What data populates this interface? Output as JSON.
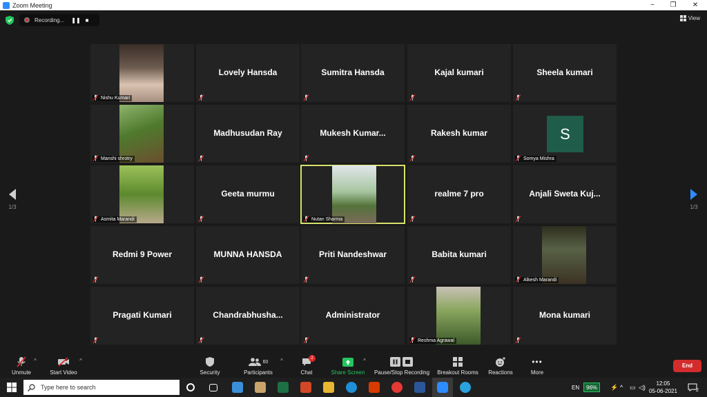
{
  "window": {
    "title": "Zoom Meeting",
    "minimize": "−",
    "maximize": "❐",
    "close": "✕"
  },
  "recording": {
    "status": "Recording...",
    "pause": "❚❚",
    "stop": "■"
  },
  "view": {
    "label": "View"
  },
  "pager": {
    "left": "1/3",
    "right": "1/3"
  },
  "participants": [
    {
      "name": "Nishu Kumari",
      "video": true
    },
    {
      "name": "Lovely Hansda",
      "video": false
    },
    {
      "name": "Sumitra Hansda",
      "video": false
    },
    {
      "name": "Kajal kumari",
      "video": false
    },
    {
      "name": "Sheela kumari",
      "video": false
    },
    {
      "name": "Manshi shrotry",
      "video": true
    },
    {
      "name": "Madhusudan Ray",
      "video": false
    },
    {
      "name": "Mukesh  Kumar...",
      "video": false
    },
    {
      "name": "Rakesh kumar",
      "video": false
    },
    {
      "name": "Somya Mishra",
      "video": false,
      "avatar": "S"
    },
    {
      "name": "Asmita Marandi",
      "video": true
    },
    {
      "name": "Geeta murmu",
      "video": false
    },
    {
      "name": "Nutan Sharma",
      "video": true,
      "active": true
    },
    {
      "name": "realme 7 pro",
      "video": false
    },
    {
      "name": "Anjali  Sweta  Kuj...",
      "video": false
    },
    {
      "name": "Redmi 9 Power",
      "video": false
    },
    {
      "name": "MUNNA HANSDA",
      "video": false
    },
    {
      "name": "Priti Nandeshwar",
      "video": false
    },
    {
      "name": "Babita kumari",
      "video": false
    },
    {
      "name": "Alkesh Marandi",
      "video": true
    },
    {
      "name": "Pragati Kumari",
      "video": false
    },
    {
      "name": "Chandrabhusha...",
      "video": false
    },
    {
      "name": "Administrator",
      "video": false
    },
    {
      "name": "Reshma Agrawal",
      "video": true
    },
    {
      "name": "Mona kumari",
      "video": false
    }
  ],
  "toolbar": {
    "unmute": "Unmute",
    "start_video": "Start Video",
    "security": "Security",
    "participants": "Participants",
    "participants_count": "60",
    "chat": "Chat",
    "chat_badge": "2",
    "share_screen": "Share Screen",
    "recording": "Pause/Stop Recording",
    "breakout": "Breakout Rooms",
    "reactions": "Reactions",
    "more": "More",
    "end": "End"
  },
  "taskbar": {
    "search_placeholder": "Type here to search",
    "lang": "EN",
    "battery": "96%",
    "time": "12:05",
    "date": "05-06-2021",
    "notifications": "2"
  },
  "colors": {
    "accent": "#2d8cff",
    "active_border": "#d7e36b",
    "end": "#d32c2c",
    "share": "#22c55e",
    "avatar": "#1f5c4a"
  }
}
